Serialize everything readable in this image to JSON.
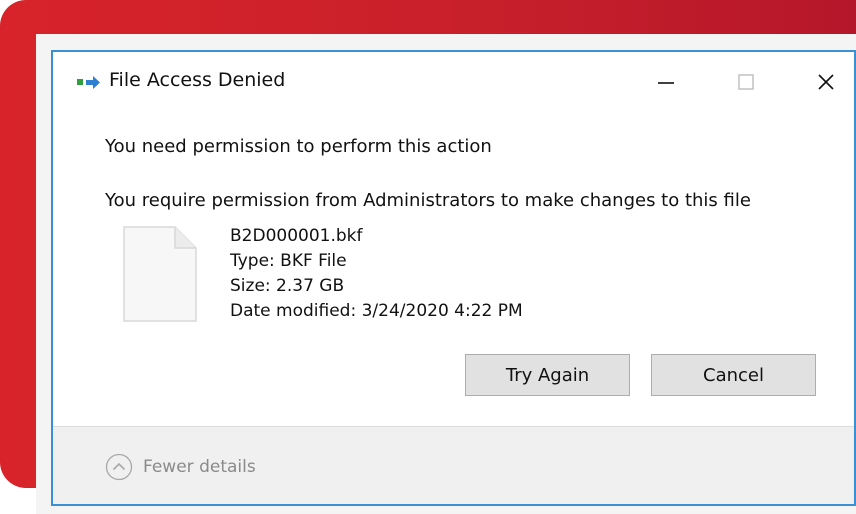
{
  "window": {
    "title": "File Access Denied",
    "icon": "file-move-icon",
    "controls": [
      "minimize-icon",
      "maximize-icon",
      "close-icon"
    ]
  },
  "message": {
    "heading": "You need permission to perform this action",
    "detail": "You require permission from Administrators to make changes to this file"
  },
  "file": {
    "icon": "document-icon",
    "name": "B2D000001.bkf",
    "type": "Type: BKF File",
    "size": "Size: 2.37 GB",
    "date_modified": "Date modified: 3/24/2020 4:22 PM"
  },
  "buttons": {
    "try_again": "Try Again",
    "cancel": "Cancel"
  },
  "footer": {
    "details_label": "Fewer details",
    "icon": "chevron-up-icon"
  },
  "colors": {
    "backdrop_red": "#d8232a",
    "window_border": "#3b8fd4",
    "button_face": "#e1e1e1"
  }
}
